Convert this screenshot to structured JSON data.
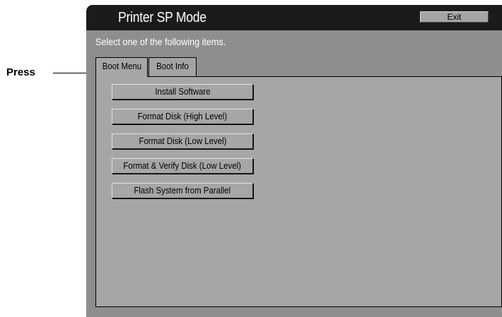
{
  "callout": {
    "label": "Press"
  },
  "window": {
    "title": "Printer SP Mode",
    "exit_label": "Exit",
    "instruction": "Select one of the following items."
  },
  "tabs": [
    {
      "label": "Boot Menu",
      "selected": true
    },
    {
      "label": "Boot Info",
      "selected": false
    }
  ],
  "menu": {
    "items": [
      {
        "label": "Install Software"
      },
      {
        "label": "Format Disk (High Level)"
      },
      {
        "label": "Format Disk (Low Level)"
      },
      {
        "label": "Format & Verify Disk (Low Level)"
      },
      {
        "label": "Flash System from Parallel"
      }
    ]
  },
  "colors": {
    "panel_frame": "#1b1b1b",
    "header_band": "#8e8e8e",
    "content_bg": "#a6a6a6",
    "title_text": "#ffffff"
  }
}
